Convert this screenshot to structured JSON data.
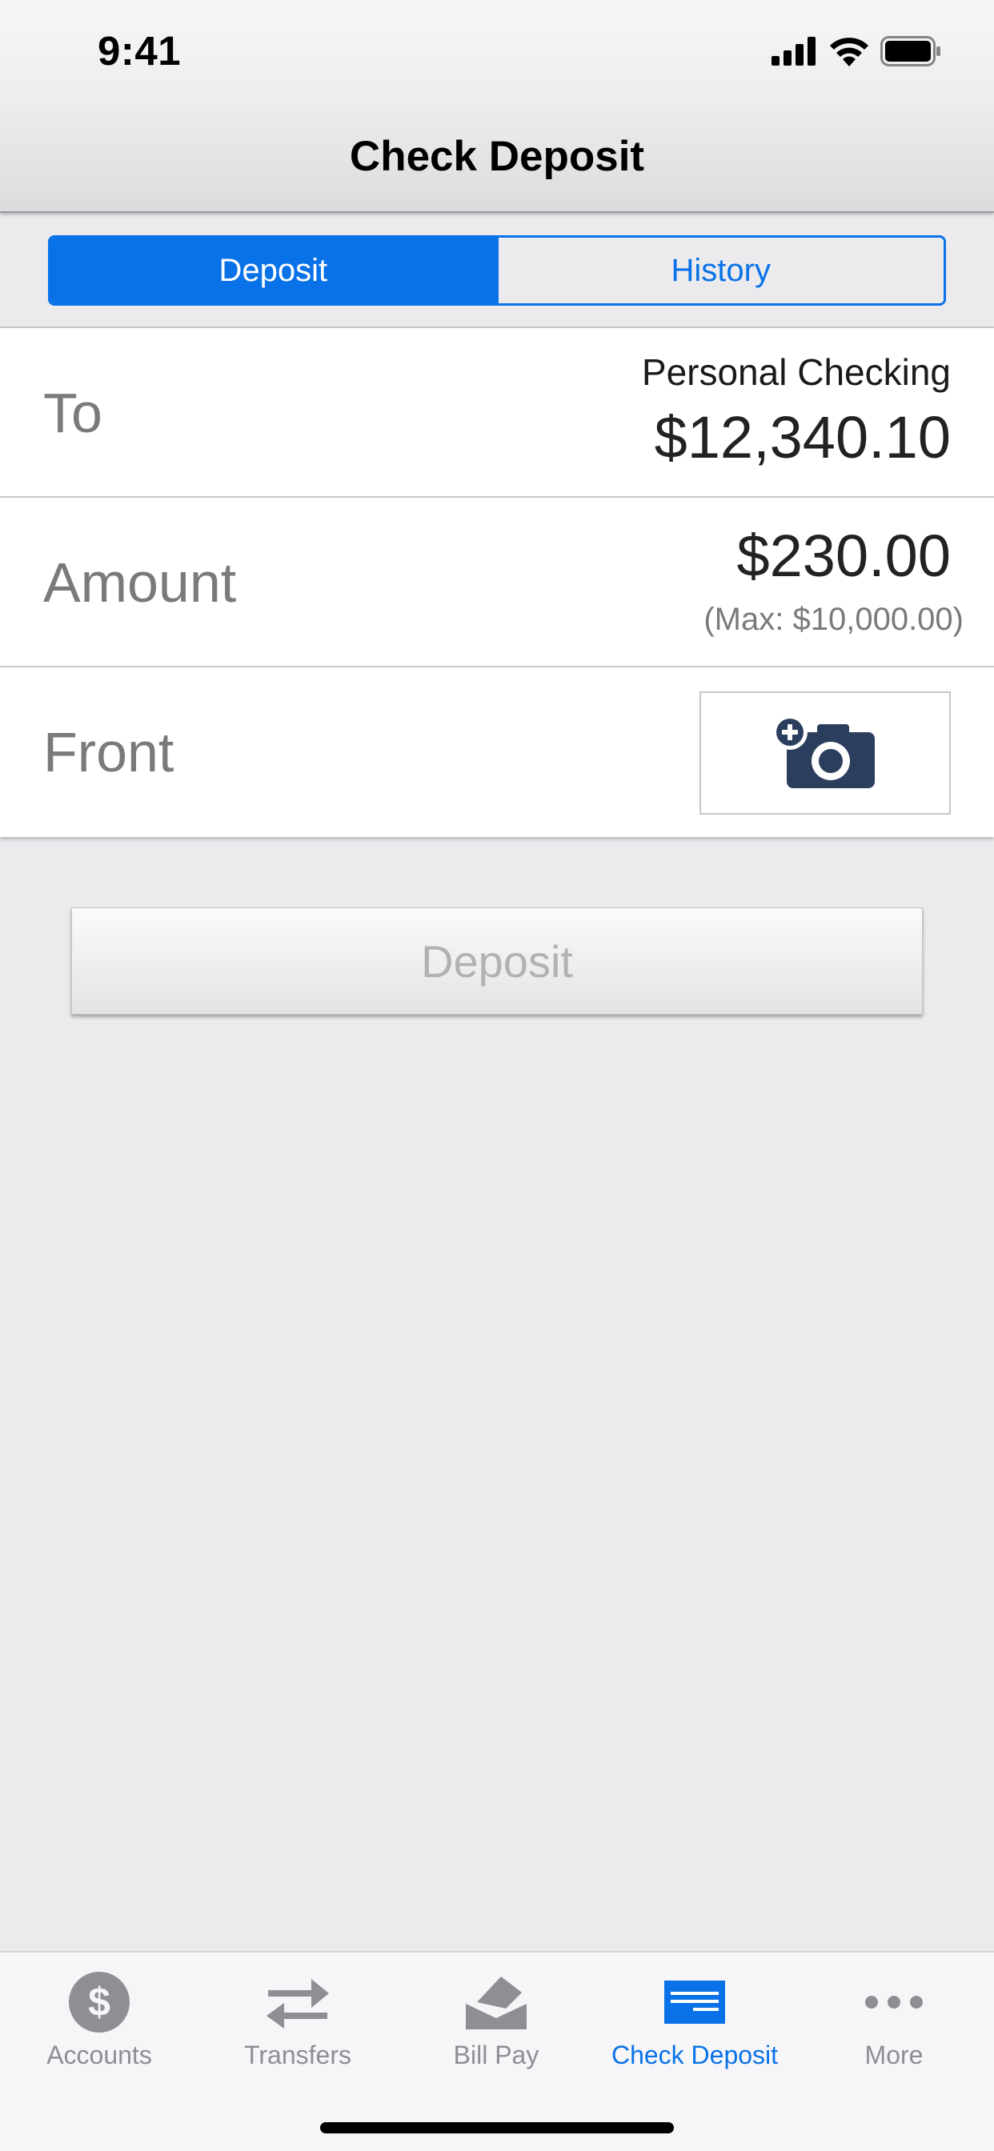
{
  "status_bar": {
    "time": "9:41"
  },
  "nav": {
    "title": "Check Deposit"
  },
  "segments": {
    "deposit": "Deposit",
    "history": "History"
  },
  "to_row": {
    "label": "To",
    "account": "Personal Checking",
    "balance": "$12,340.10"
  },
  "amount_row": {
    "label": "Amount",
    "value": "$230.00",
    "max": "(Max: $10,000.00)"
  },
  "front_row": {
    "label": "Front",
    "icon": "add-camera-icon"
  },
  "deposit_button": {
    "label": "Deposit",
    "enabled": false
  },
  "tabbar": {
    "items": [
      {
        "label": "Accounts",
        "icon": "dollar-circle-icon",
        "active": false
      },
      {
        "label": "Transfers",
        "icon": "transfer-arrows-icon",
        "active": false
      },
      {
        "label": "Bill Pay",
        "icon": "envelope-icon",
        "active": false
      },
      {
        "label": "Check Deposit",
        "icon": "check-icon",
        "active": true
      },
      {
        "label": "More",
        "icon": "more-dots-icon",
        "active": false
      }
    ]
  },
  "colors": {
    "accent": "#0a72e8",
    "camera": "#2c3e5e",
    "inactive_icon": "#8e8e93"
  }
}
